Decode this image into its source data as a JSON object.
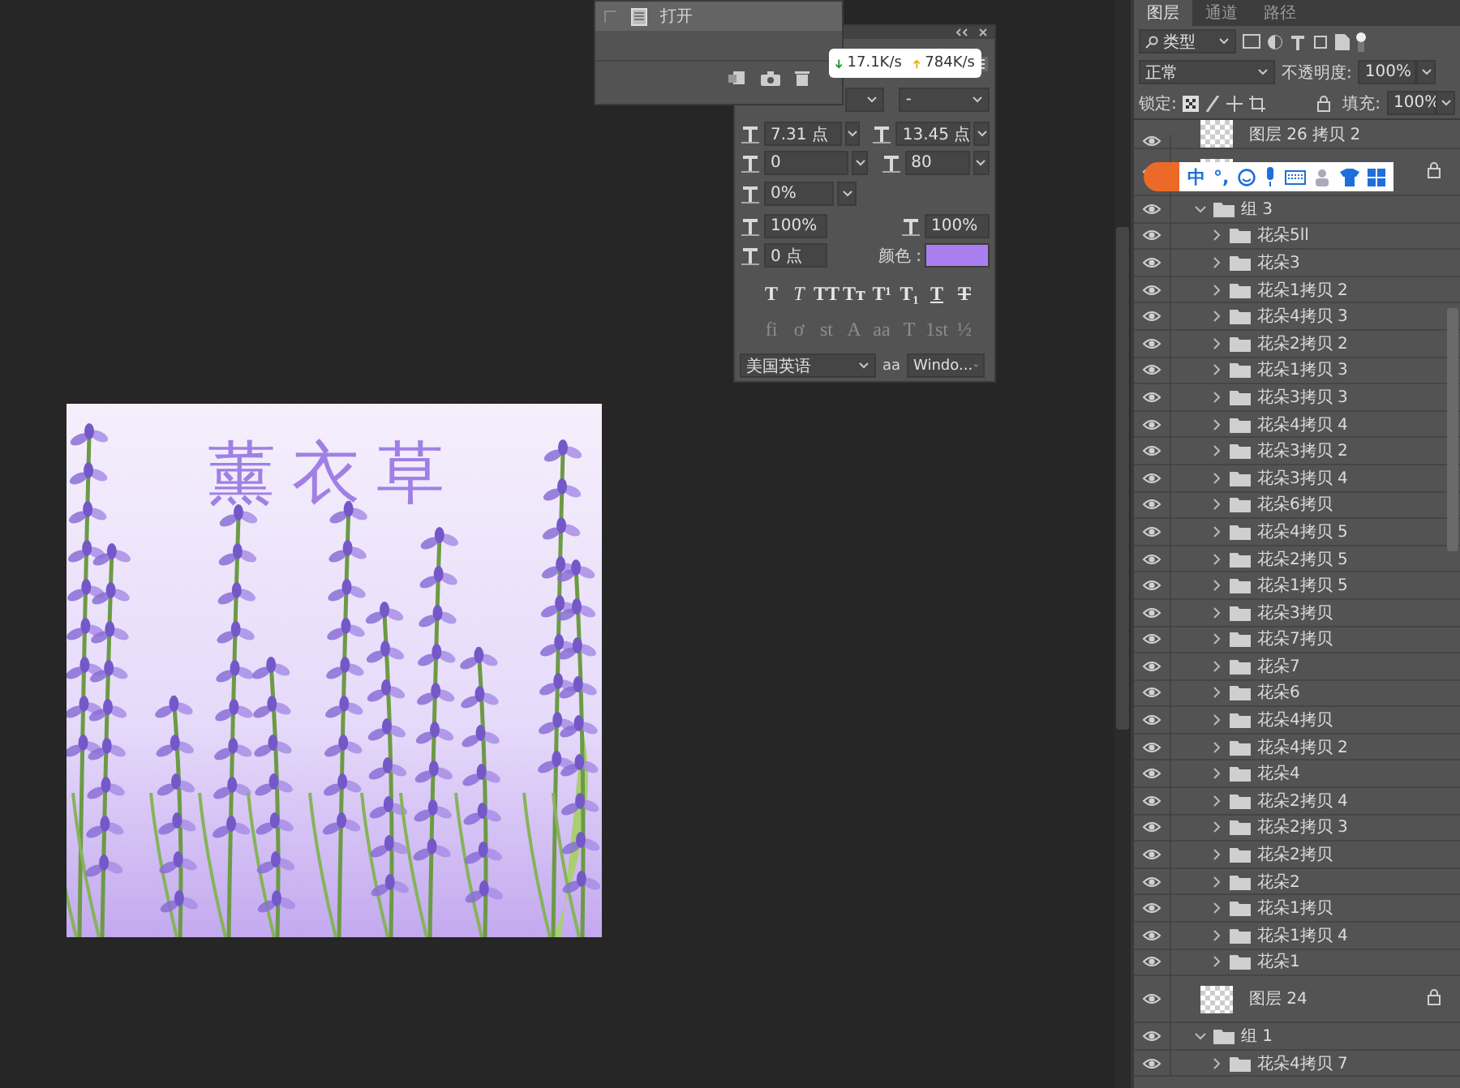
{
  "history_panel": {
    "items": [
      {
        "label": "打开",
        "selected": true
      }
    ]
  },
  "network_speed": {
    "download": "17.1K/s",
    "upload": "784K/s"
  },
  "character_panel": {
    "font_style": "-",
    "font_size": "7.31 点",
    "leading": "13.45 点",
    "kerning": "0",
    "tracking": "80",
    "tsume": "0%",
    "vertical_scale": "100%",
    "horizontal_scale": "100%",
    "baseline_shift": "0 点",
    "color_label": "颜色 :",
    "color": "#a97ff0",
    "style_buttons": [
      {
        "label": "T",
        "kind": "bold"
      },
      {
        "label": "T",
        "kind": "italic"
      },
      {
        "label": "TT",
        "kind": "caps"
      },
      {
        "label": "Tт",
        "kind": "caps"
      },
      {
        "label": "T¹",
        "kind": "caps"
      },
      {
        "label": "T₁",
        "kind": "caps"
      },
      {
        "label": "T",
        "kind": "underline"
      },
      {
        "label": "T",
        "kind": "strike"
      }
    ],
    "opentype_buttons": [
      {
        "label": "fi",
        "disabled": true
      },
      {
        "label": "ơ",
        "disabled": true
      },
      {
        "label": "st",
        "disabled": true
      },
      {
        "label": "A",
        "disabled": true
      },
      {
        "label": "aa",
        "disabled": true
      },
      {
        "label": "T",
        "disabled": true
      },
      {
        "label": "1st",
        "disabled": true
      },
      {
        "label": "½",
        "disabled": true
      }
    ],
    "language": "美国英语",
    "antialias_label": "aa",
    "antialias": "Windo..."
  },
  "canvas": {
    "title": "薰衣草"
  },
  "ime_toolbar": {
    "mode": "中",
    "punctuation": "°,"
  },
  "layers_panel": {
    "tabs": [
      {
        "label": "图层",
        "selected": true
      },
      {
        "label": "通道",
        "selected": false
      },
      {
        "label": "路径",
        "selected": false
      }
    ],
    "filter": "类型",
    "blend_mode": "正常",
    "opacity_label": "不透明度:",
    "opacity": "100%",
    "lock_label": "锁定:",
    "fill_label": "填充:",
    "fill": "100%",
    "layers": [
      {
        "kind": "layer",
        "name": "图层 26 拷贝 2"
      },
      {
        "kind": "layer",
        "locked": true
      },
      {
        "kind": "group",
        "name": "组 3",
        "expanded": true,
        "children": [
          {
            "kind": "group",
            "name": "花朵5ll",
            "expanded": false
          },
          {
            "kind": "group",
            "name": "花朵3",
            "expanded": false
          },
          {
            "kind": "group",
            "name": "花朵1拷贝 2",
            "expanded": false
          },
          {
            "kind": "group",
            "name": "花朵4拷贝 3",
            "expanded": false
          },
          {
            "kind": "group",
            "name": "花朵2拷贝 2",
            "expanded": false
          },
          {
            "kind": "group",
            "name": "花朵1拷贝 3",
            "expanded": false
          },
          {
            "kind": "group",
            "name": "花朵3拷贝 3",
            "expanded": false
          },
          {
            "kind": "group",
            "name": "花朵4拷贝 4",
            "expanded": false
          },
          {
            "kind": "group",
            "name": "花朵3拷贝 2",
            "expanded": false
          },
          {
            "kind": "group",
            "name": "花朵3拷贝 4",
            "expanded": false
          },
          {
            "kind": "group",
            "name": "花朵6拷贝",
            "expanded": false
          },
          {
            "kind": "group",
            "name": "花朵4拷贝 5",
            "expanded": false
          },
          {
            "kind": "group",
            "name": "花朵2拷贝 5",
            "expanded": false
          },
          {
            "kind": "group",
            "name": "花朵1拷贝 5",
            "expanded": false
          },
          {
            "kind": "group",
            "name": "花朵3拷贝",
            "expanded": false
          },
          {
            "kind": "group",
            "name": "花朵7拷贝",
            "expanded": false
          },
          {
            "kind": "group",
            "name": "花朵7",
            "expanded": false
          },
          {
            "kind": "group",
            "name": "花朵6",
            "expanded": false
          },
          {
            "kind": "group",
            "name": "花朵4拷贝",
            "expanded": false
          },
          {
            "kind": "group",
            "name": "花朵4拷贝 2",
            "expanded": false
          },
          {
            "kind": "group",
            "name": "花朵4",
            "expanded": false
          },
          {
            "kind": "group",
            "name": "花朵2拷贝 4",
            "expanded": false
          },
          {
            "kind": "group",
            "name": "花朵2拷贝 3",
            "expanded": false
          },
          {
            "kind": "group",
            "name": "花朵2拷贝",
            "expanded": false
          },
          {
            "kind": "group",
            "name": "花朵2",
            "expanded": false
          },
          {
            "kind": "group",
            "name": "花朵1拷贝",
            "expanded": false
          },
          {
            "kind": "group",
            "name": "花朵1拷贝 4",
            "expanded": false
          },
          {
            "kind": "group",
            "name": "花朵1",
            "expanded": false
          }
        ]
      },
      {
        "kind": "layer",
        "name": "图层 24",
        "locked": true
      },
      {
        "kind": "group",
        "name": "组 1",
        "expanded": true,
        "children": [
          {
            "kind": "group",
            "name": "花朵4拷贝 7",
            "expanded": false
          }
        ]
      }
    ]
  }
}
